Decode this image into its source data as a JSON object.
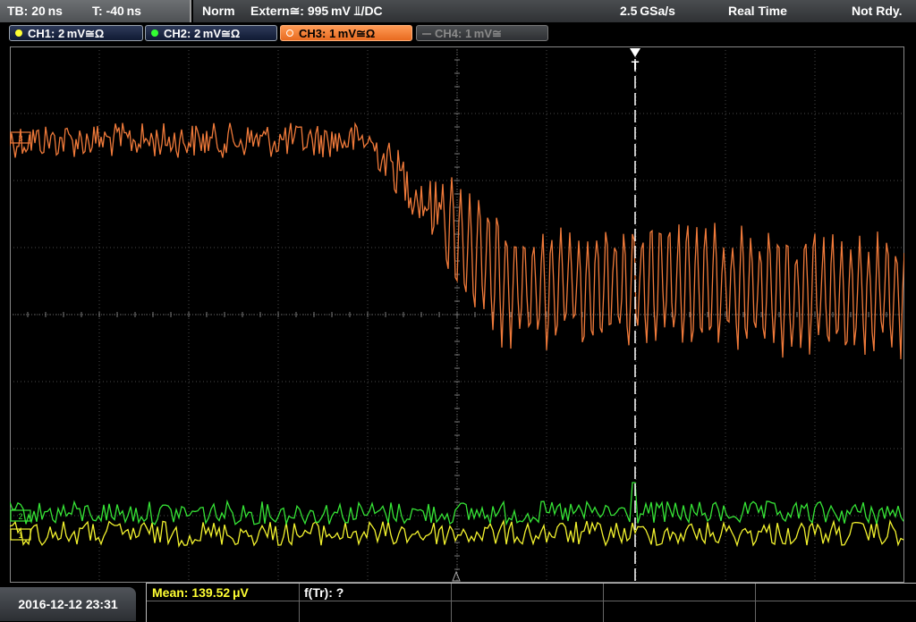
{
  "header": {
    "timebase": "TB: 20 ns",
    "trigger_offset": "T: -40 ns",
    "trigger_mode": "Norm",
    "trigger_source": "Extern≅: 995 mV ⫫/DC",
    "sample_rate": "2.5 GSa/s",
    "acq_mode": "Real Time",
    "status": "Not Rdy."
  },
  "channels": [
    {
      "label": "CH1: 2 mV≅Ω",
      "color": "#ffff33",
      "active": false,
      "enabled": true
    },
    {
      "label": "CH2: 2 mV≅Ω",
      "color": "#33ff33",
      "active": false,
      "enabled": true
    },
    {
      "label": "CH3: 1 mV≅Ω",
      "color": "#ff8c3a",
      "active": true,
      "enabled": true
    },
    {
      "label": "CH4: 1 mV≅",
      "color": "#777777",
      "active": false,
      "enabled": false
    }
  ],
  "footer": {
    "datetime": "2016-12-12 23:31",
    "meas1": "Mean: 139.52 μV",
    "meas2": "f(Tr): ?"
  },
  "trigger_marker": "T",
  "colors": {
    "ch1": "#f3f32e",
    "ch2": "#36e436",
    "ch3": "#f07a3a",
    "grid": "#4a4a4a",
    "meas_yellow": "#ffff33"
  }
}
